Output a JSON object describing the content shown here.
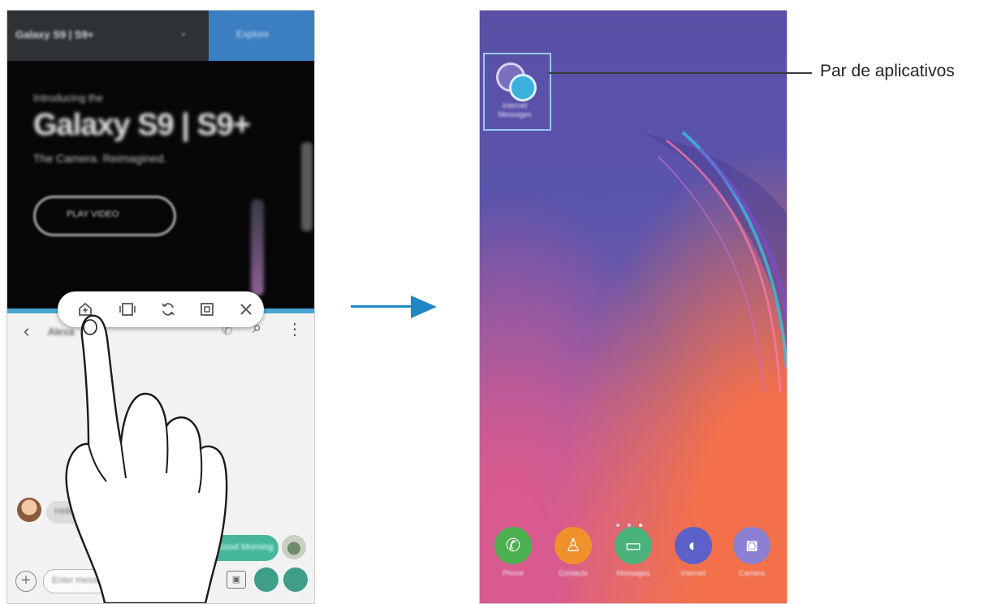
{
  "left_screen": {
    "browser": {
      "tab_title": "Galaxy S9 | S9+",
      "tab_caret": "⌄",
      "top_button": "Explore"
    },
    "hero": {
      "kicker": "Introducing the",
      "title": "Galaxy S9 | S9+",
      "subtitle": "The Camera. Reimagined.",
      "button": "PLAY VIDEO"
    },
    "messages": {
      "back_icon": "‹",
      "contact_name": "Alexa",
      "call_icon": "✆",
      "search_icon": "⌕",
      "more_icon": "⋮",
      "incoming_message": "Hello",
      "outgoing_message": "Good Morning",
      "input_placeholder": "Enter message",
      "add_icon": "+",
      "sticker_icon": "▣"
    },
    "popup_toolbar": {
      "icons": [
        "add-app-pair-icon",
        "split-view-icon",
        "swap-windows-icon",
        "popup-view-icon",
        "close-icon"
      ]
    }
  },
  "right_screen": {
    "app_pair_label": "Internet\nMessages",
    "page_indicator_count": 3,
    "dock": [
      {
        "label": "Phone",
        "color": "#4caf50",
        "glyph": "✆",
        "icon": "phone-icon"
      },
      {
        "label": "Contacts",
        "color": "#f0922b",
        "glyph": "♙",
        "icon": "contacts-icon"
      },
      {
        "label": "Messages",
        "color": "#4ab27a",
        "glyph": "▭",
        "icon": "messages-icon"
      },
      {
        "label": "Internet",
        "color": "#5b61c8",
        "glyph": "◐",
        "icon": "internet-icon"
      },
      {
        "label": "Camera",
        "color": "#8a7fd0",
        "glyph": "◙",
        "icon": "camera-icon"
      }
    ]
  },
  "callout": {
    "text": "Par de aplicativos"
  },
  "colors": {
    "arrow": "#1f87c7",
    "highlight": "#9ac9ee",
    "divider": "#4aa6d3"
  }
}
